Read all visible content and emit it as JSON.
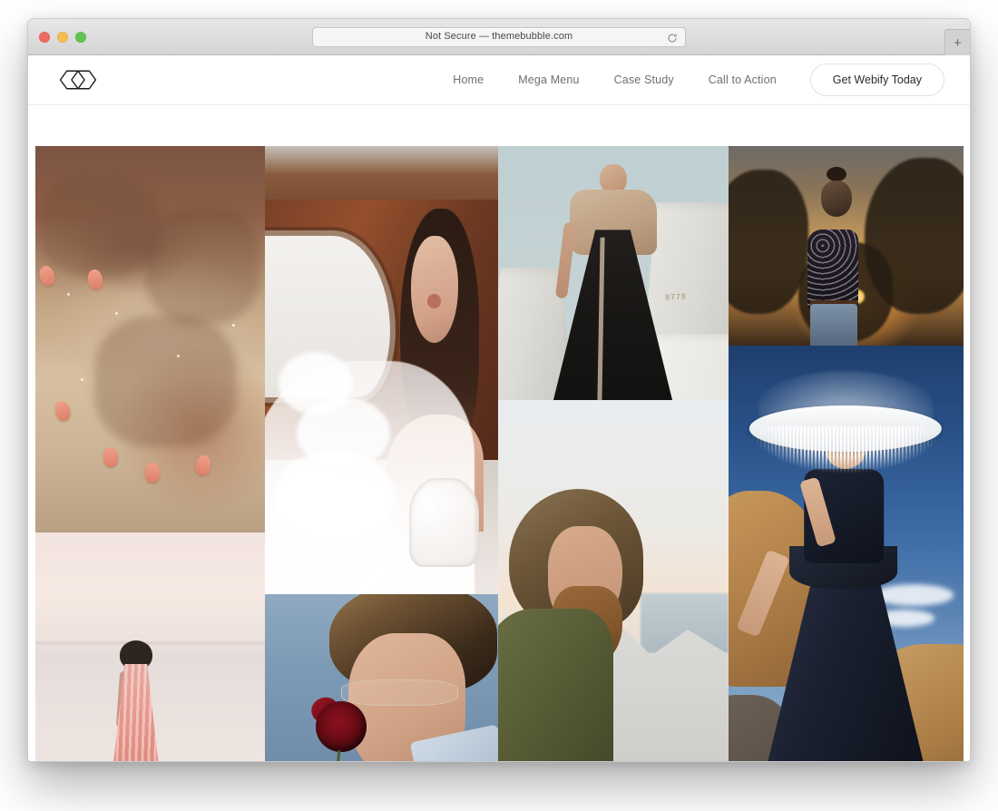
{
  "browser": {
    "traffic_lights": [
      {
        "name": "close",
        "color": "#ec6a5f"
      },
      {
        "name": "minimize",
        "color": "#f4bf4f"
      },
      {
        "name": "zoom",
        "color": "#61c554"
      }
    ],
    "url_text": "Not Secure — themebubble.com",
    "reload_icon": "reload-icon",
    "new_tab_label": "+"
  },
  "site": {
    "logo_name": "webify-logo",
    "nav": [
      {
        "label": "Home"
      },
      {
        "label": "Mega Menu"
      },
      {
        "label": "Case Study"
      },
      {
        "label": "Call to Action"
      }
    ],
    "cta_label": "Get Webify Today"
  },
  "gallery": {
    "tiles": [
      {
        "id": "hands",
        "alt": "Hands resting on wet sand with coral nail polish"
      },
      {
        "id": "bride",
        "alt": "Bride in white tulle gown inside a wooden boat cabin"
      },
      {
        "id": "skirt",
        "alt": "Woman in beige top and long black skirt among concrete forms"
      },
      {
        "id": "sunset",
        "alt": "Woman in floral blouse silhouetted against a golden sunset"
      },
      {
        "id": "gown",
        "alt": "Woman in navy gown wearing a white fringed hat in the desert"
      },
      {
        "id": "lake",
        "alt": "Woman in pink dress standing in still water at dawn"
      },
      {
        "id": "rose",
        "alt": "Man with curly hair and glasses holding a red rose"
      },
      {
        "id": "beard",
        "alt": "Bearded man in olive shirt looking down at a rocky coast"
      }
    ],
    "concrete_marking": "8778"
  },
  "colors": {
    "page_background": "#ffffff",
    "nav_text": "#6f6f6f",
    "cta_text": "#2b2b2b",
    "chrome_background": "#dcdcdc"
  }
}
